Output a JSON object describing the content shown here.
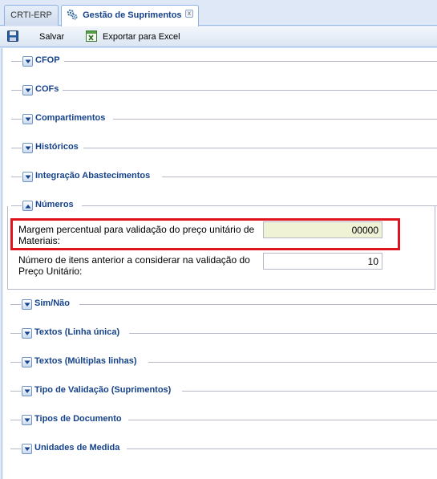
{
  "tabs": {
    "inactive_label": "CRTI-ERP",
    "active_label": "Gestão de Suprimentos",
    "close_symbol": "x"
  },
  "toolbar": {
    "save_label": "Salvar",
    "export_label": "Exportar para Excel"
  },
  "sections": {
    "cfop": "CFOP",
    "cofs": "COFs",
    "compartimentos": "Compartimentos",
    "historicos": "Históricos",
    "integracao": "Integração Abastecimentos",
    "numeros": "Números",
    "sim_nao": "Sim/Não",
    "textos_linha": "Textos (Linha única)",
    "textos_multiplas": "Textos (Múltiplas linhas)",
    "tipo_validacao": "Tipo de Validação (Suprimentos)",
    "tipos_documento": "Tipos de Documento",
    "unidades_medida": "Unidades de Medida"
  },
  "numeros_fields": {
    "margem_label_1": "Margem percentual para validação do preço unitário de",
    "margem_label_2": "Materiais:",
    "margem_value": "00000",
    "itens_label_1": "Número de itens anterior a considerar na validação do",
    "itens_label_2": "Preço Unitário:",
    "itens_value": "10"
  },
  "colors": {
    "accent": "#15428b",
    "highlight": "#e0141e",
    "focused_input": "#f0f2d6"
  },
  "icons": [
    "gear-icon",
    "floppy-disk-icon",
    "excel-icon",
    "chevron-down-icon",
    "chevron-up-icon",
    "close-icon"
  ]
}
